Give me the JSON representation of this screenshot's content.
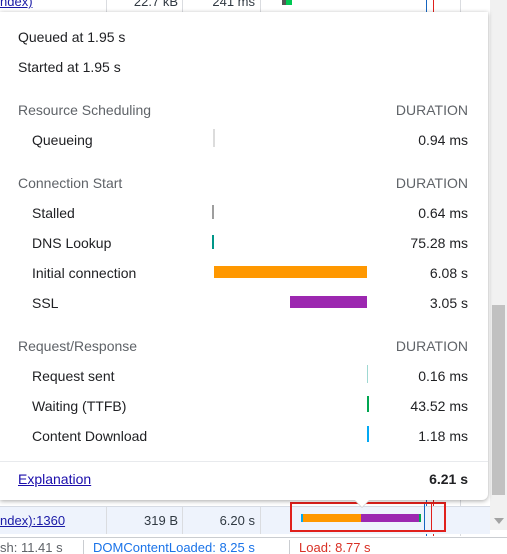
{
  "background_rows": {
    "top": {
      "name": "ndex)",
      "size": "22.7 kB",
      "time": "241 ms"
    },
    "bottom": {
      "name": "ndex):1360",
      "size": "319 B",
      "time": "6.20 s"
    }
  },
  "status_bar": {
    "finish": "sh: 11.41 s",
    "dom_content_loaded": "DOMContentLoaded: 8.25 s",
    "load": "Load: 8.77 s"
  },
  "timing": {
    "queued_at": "Queued at 1.95 s",
    "started_at": "Started at 1.95 s",
    "sections": [
      {
        "title": "Resource Scheduling",
        "duration_label": "DURATION",
        "rows": [
          {
            "label": "Queueing",
            "value": "0.94 ms"
          }
        ]
      },
      {
        "title": "Connection Start",
        "duration_label": "DURATION",
        "rows": [
          {
            "label": "Stalled",
            "value": "0.64 ms"
          },
          {
            "label": "DNS Lookup",
            "value": "75.28 ms"
          },
          {
            "label": "Initial connection",
            "value": "6.08 s"
          },
          {
            "label": "SSL",
            "value": "3.05 s"
          }
        ]
      },
      {
        "title": "Request/Response",
        "duration_label": "DURATION",
        "rows": [
          {
            "label": "Request sent",
            "value": "0.16 ms"
          },
          {
            "label": "Waiting (TTFB)",
            "value": "43.52 ms"
          },
          {
            "label": "Content Download",
            "value": "1.18 ms"
          }
        ]
      }
    ],
    "explanation_link": "Explanation",
    "total": "6.21 s"
  },
  "colors": {
    "queueing": "#c8c8c8",
    "stalled": "#9e9e9e",
    "dns": "#009688",
    "initial_connection": "#ff9800",
    "ssl": "#9c27b0",
    "request_sent": "#1db6a8",
    "waiting": "#00a651",
    "content_download": "#03a9f4",
    "dom_content_loaded_line": "#1565c0",
    "load_line": "#e0201c",
    "highlight_border": "#e0201c"
  }
}
